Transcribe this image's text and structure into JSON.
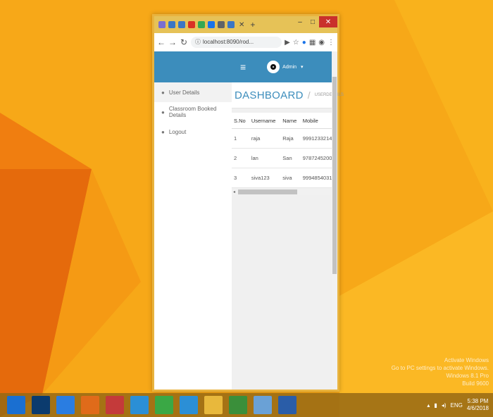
{
  "colors": {
    "wallpaper": "#f6a51a",
    "title_bar": "#e6c257",
    "app_header": "#3c8dbc",
    "close_button": "#c9302c"
  },
  "desktop": {
    "watermark_lines": [
      "Activate Windows",
      "Go to PC settings to activate Windows.",
      "Windows 8.1 Pro",
      "Build 9600"
    ]
  },
  "browser": {
    "tabs": [
      {
        "icon": "tab-favicon",
        "color": "#7a6fd1"
      },
      {
        "icon": "tab-favicon",
        "color": "#3b76c4"
      },
      {
        "icon": "tab-favicon",
        "color": "#3b76c4"
      },
      {
        "icon": "tab-favicon",
        "color": "#d93025"
      },
      {
        "icon": "tab-favicon",
        "color": "#34a853"
      },
      {
        "icon": "tab-favicon",
        "color": "#1a73e8"
      },
      {
        "icon": "tab-favicon",
        "color": "#5f6368"
      },
      {
        "icon": "tab-favicon",
        "color": "#3b76c4"
      }
    ],
    "url": "localhost:8090/rod..."
  },
  "app": {
    "sidebar": {
      "items": [
        {
          "label": "User Details",
          "active": true
        },
        {
          "label": "Classroom Booked Details",
          "active": false
        },
        {
          "label": "Logout",
          "active": false
        }
      ]
    },
    "topnav": {
      "user_label": "Admin"
    },
    "page": {
      "title": "DASHBOARD",
      "separator": "/",
      "crumb": "USERDETAILS"
    },
    "table": {
      "headers": [
        "S.No",
        "Username",
        "Name",
        "Mobile"
      ],
      "rows": [
        [
          "1",
          "raja",
          "Raja",
          "9991233214"
        ],
        [
          "2",
          "lan",
          "San",
          "9787245200"
        ],
        [
          "3",
          "siva123",
          "siva",
          "9994854031"
        ]
      ]
    }
  },
  "taskbar": {
    "apps": [
      {
        "icon": "windows-start-icon",
        "color": "#1a6fd1"
      },
      {
        "icon": "photoshop-icon",
        "color": "#0b3b6e"
      },
      {
        "icon": "chrome-icon",
        "color": "#2a7de1"
      },
      {
        "icon": "firefox-icon",
        "color": "#e06b1a"
      },
      {
        "icon": "app-icon",
        "color": "#c43a3a"
      },
      {
        "icon": "internet-explorer-icon",
        "color": "#2b8fd6"
      },
      {
        "icon": "app-icon",
        "color": "#3aa845"
      },
      {
        "icon": "internet-explorer-icon",
        "color": "#2b8fd6"
      },
      {
        "icon": "file-explorer-icon",
        "color": "#e8b83c"
      },
      {
        "icon": "app-icon",
        "color": "#3a8f3a"
      },
      {
        "icon": "app-icon",
        "color": "#6aa1d6"
      },
      {
        "icon": "app-icon",
        "color": "#2a5da8"
      }
    ],
    "tray": {
      "lang": "ENG",
      "time": "5:38 PM",
      "date": "4/6/2018"
    }
  }
}
